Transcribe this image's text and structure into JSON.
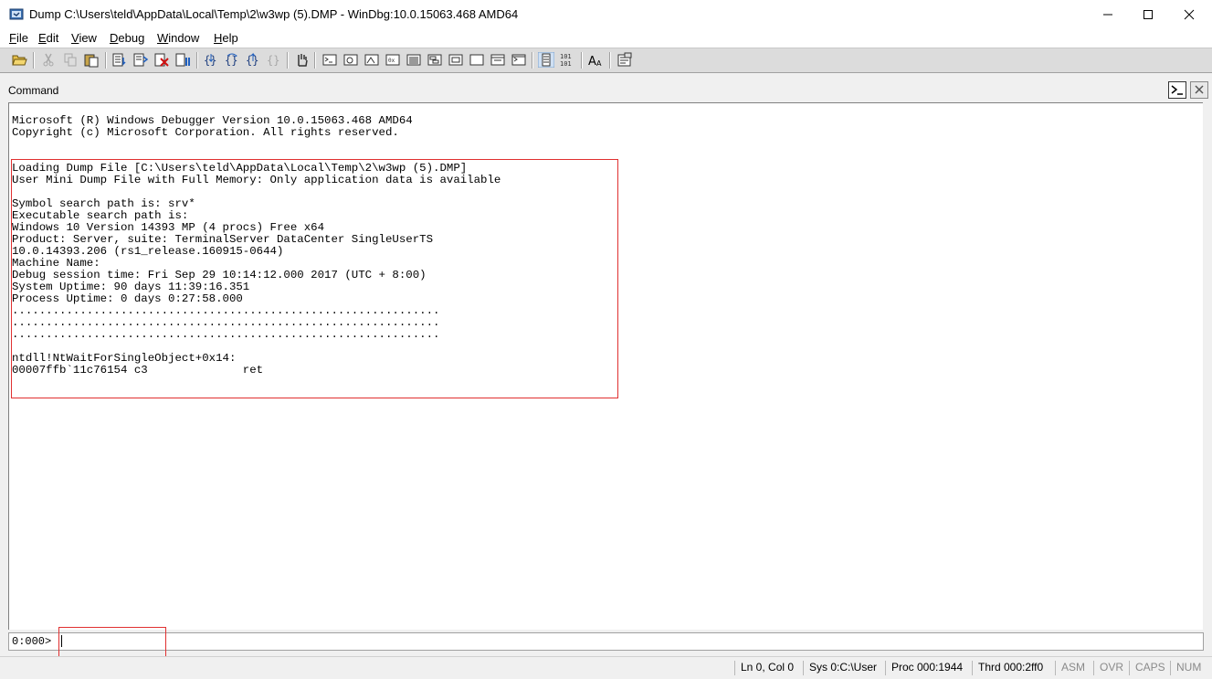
{
  "window": {
    "title": "Dump C:\\Users\\teld\\AppData\\Local\\Temp\\2\\w3wp (5).DMP - WinDbg:10.0.15063.468 AMD64"
  },
  "menu": [
    {
      "name": "file",
      "label": "File"
    },
    {
      "name": "edit",
      "label": "Edit"
    },
    {
      "name": "view",
      "label": "View"
    },
    {
      "name": "debug",
      "label": "Debug"
    },
    {
      "name": "window",
      "label": "Window"
    },
    {
      "name": "help",
      "label": "Help"
    }
  ],
  "command_window": {
    "title": "Command",
    "output": "Microsoft (R) Windows Debugger Version 10.0.15063.468 AMD64\nCopyright (c) Microsoft Corporation. All rights reserved.\n\n\nLoading Dump File [C:\\Users\\teld\\AppData\\Local\\Temp\\2\\w3wp (5).DMP]\nUser Mini Dump File with Full Memory: Only application data is available\n\nSymbol search path is: srv*\nExecutable search path is:\nWindows 10 Version 14393 MP (4 procs) Free x64\nProduct: Server, suite: TerminalServer DataCenter SingleUserTS\n10.0.14393.206 (rs1_release.160915-0644)\nMachine Name:\nDebug session time: Fri Sep 29 10:14:12.000 2017 (UTC + 8:00)\nSystem Uptime: 90 days 11:39:16.351\nProcess Uptime: 0 days 0:27:58.000\n...............................................................\n...............................................................\n...............................................................\n\nntdll!NtWaitForSingleObject+0x14:\n00007ffb`11c76154 c3              ret",
    "prompt": "0:000>",
    "input_value": ""
  },
  "status": {
    "ln_col": "Ln 0, Col 0",
    "sys": "Sys 0:C:\\User",
    "proc": "Proc 000:1944",
    "thrd": "Thrd 000:2ff0",
    "asm": "ASM",
    "ovr": "OVR",
    "caps": "CAPS",
    "num": "NUM"
  }
}
